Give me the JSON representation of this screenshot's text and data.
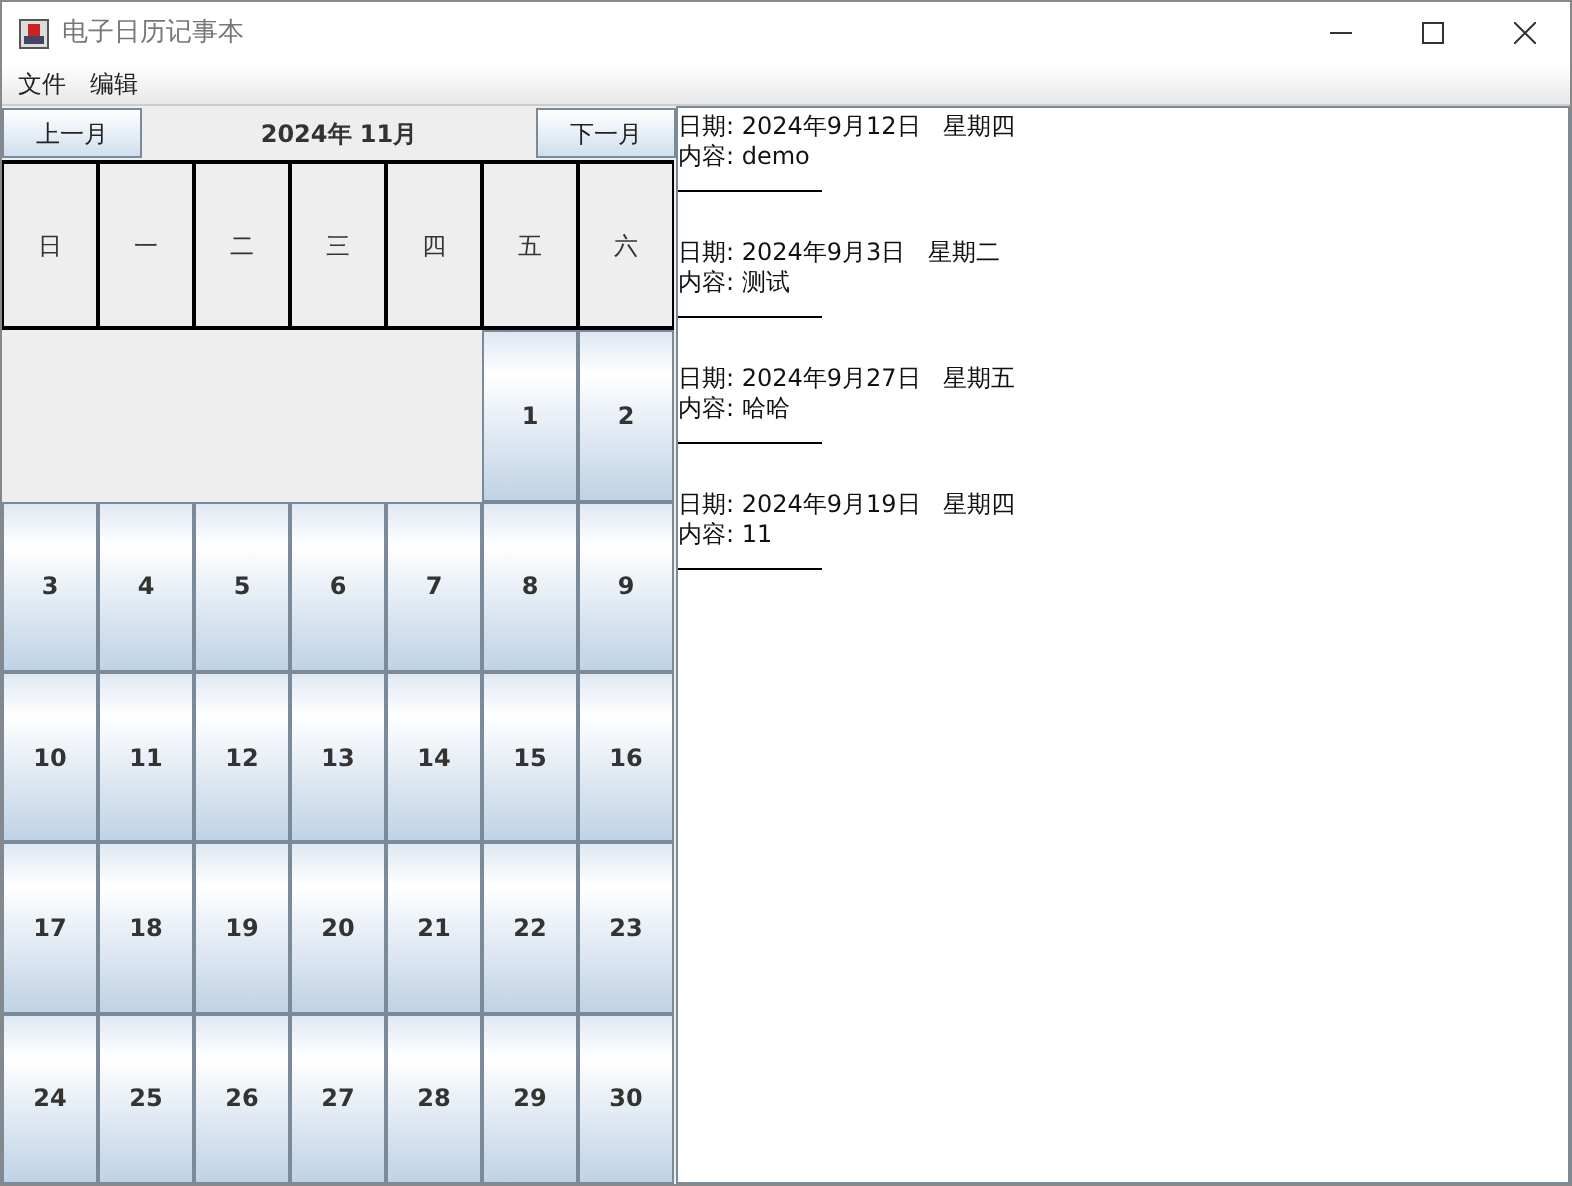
{
  "window": {
    "title": "电子日历记事本"
  },
  "menu": [
    "文件",
    "编辑"
  ],
  "calendar": {
    "prev_button": "上一月",
    "month_label": "2024年 11月",
    "next_button": "下一月",
    "weekdays": [
      "日",
      "一",
      "二",
      "三",
      "四",
      "五",
      "六"
    ],
    "cells": [
      {
        "kind": "blank"
      },
      {
        "kind": "blank"
      },
      {
        "kind": "blank"
      },
      {
        "kind": "blank"
      },
      {
        "kind": "blank"
      },
      {
        "kind": "day",
        "label": "1"
      },
      {
        "kind": "day",
        "label": "2"
      },
      {
        "kind": "day",
        "label": "3"
      },
      {
        "kind": "day",
        "label": "4"
      },
      {
        "kind": "day",
        "label": "5"
      },
      {
        "kind": "day",
        "label": "6"
      },
      {
        "kind": "day",
        "label": "7"
      },
      {
        "kind": "day",
        "label": "8"
      },
      {
        "kind": "day",
        "label": "9"
      },
      {
        "kind": "day",
        "label": "10"
      },
      {
        "kind": "day",
        "label": "11"
      },
      {
        "kind": "day",
        "label": "12"
      },
      {
        "kind": "day",
        "label": "13"
      },
      {
        "kind": "day",
        "label": "14"
      },
      {
        "kind": "day",
        "label": "15"
      },
      {
        "kind": "day",
        "label": "16"
      },
      {
        "kind": "day",
        "label": "17"
      },
      {
        "kind": "day",
        "label": "18"
      },
      {
        "kind": "day",
        "label": "19"
      },
      {
        "kind": "day",
        "label": "20"
      },
      {
        "kind": "day",
        "label": "21"
      },
      {
        "kind": "day",
        "label": "22"
      },
      {
        "kind": "day",
        "label": "23"
      },
      {
        "kind": "day",
        "label": "24"
      },
      {
        "kind": "day",
        "label": "25"
      },
      {
        "kind": "day",
        "label": "26"
      },
      {
        "kind": "day",
        "label": "27"
      },
      {
        "kind": "day",
        "label": "28"
      },
      {
        "kind": "day",
        "label": "29"
      },
      {
        "kind": "day",
        "label": "30"
      }
    ]
  },
  "notes": [
    {
      "date": "日期: 2024年9月12日   星期四",
      "content": "内容: demo"
    },
    {
      "date": "日期: 2024年9月3日   星期二",
      "content": "内容: 测试"
    },
    {
      "date": "日期: 2024年9月27日   星期五",
      "content": "内容: 哈哈"
    },
    {
      "date": "日期: 2024年9月19日   星期四",
      "content": "内容: 11"
    }
  ]
}
